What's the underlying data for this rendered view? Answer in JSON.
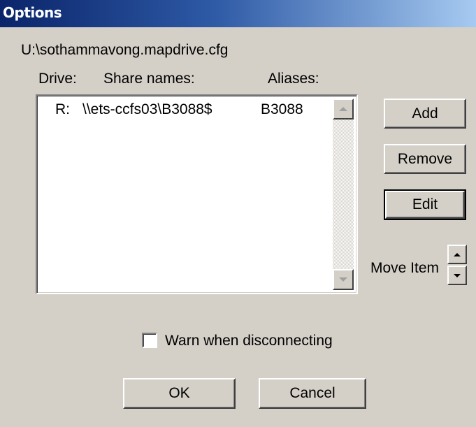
{
  "window": {
    "title": "Options"
  },
  "config_path": "U:\\sothammavong.mapdrive.cfg",
  "list": {
    "headers": {
      "drive": "Drive:",
      "share": "Share names:",
      "alias": "Aliases:"
    },
    "rows": [
      {
        "drive": "R:",
        "share": "\\\\ets-ccfs03\\B3088$",
        "alias": "B3088"
      }
    ]
  },
  "buttons": {
    "add": "Add",
    "remove": "Remove",
    "edit": "Edit",
    "ok": "OK",
    "cancel": "Cancel"
  },
  "move_item": {
    "label": "Move Item"
  },
  "warn": {
    "label": "Warn when disconnecting",
    "checked": false
  },
  "colors": {
    "titlebar_start": "#0a246a",
    "titlebar_end": "#a6caf0",
    "face": "#d4d0c8"
  }
}
